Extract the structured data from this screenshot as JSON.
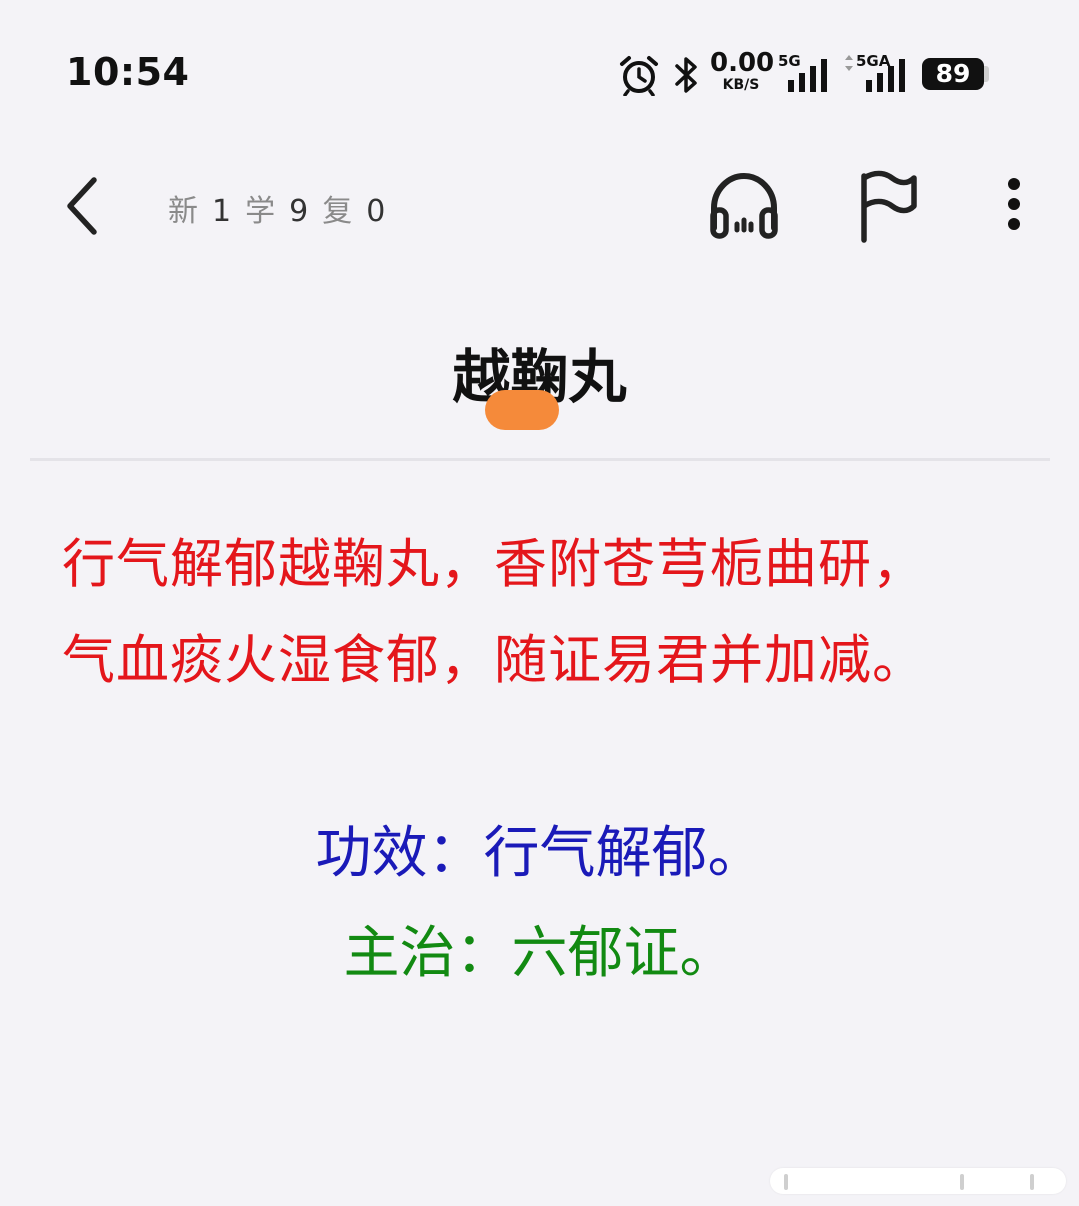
{
  "status_bar": {
    "time": "10:54",
    "net_speed_value": "0.00",
    "net_speed_unit": "KB/S",
    "sim1_label": "5G",
    "sim2_label": "5GA",
    "battery": "89"
  },
  "nav": {
    "progress": [
      {
        "label": "新",
        "value": "1"
      },
      {
        "label": "学",
        "value": "9"
      },
      {
        "label": "复",
        "value": "0"
      }
    ]
  },
  "card": {
    "title": "越鞠丸",
    "verse_line_1": "行气解郁越鞠丸，香附苍芎栀曲研，",
    "verse_line_2": "气血痰火湿食郁，随证易君并加减。",
    "effect": "功效：行气解郁。",
    "indication": "主治：六郁证。"
  },
  "colors": {
    "verse": "#e4161b",
    "effect": "#1a1ab8",
    "indication": "#128a12",
    "redaction": "#f58a3a"
  }
}
